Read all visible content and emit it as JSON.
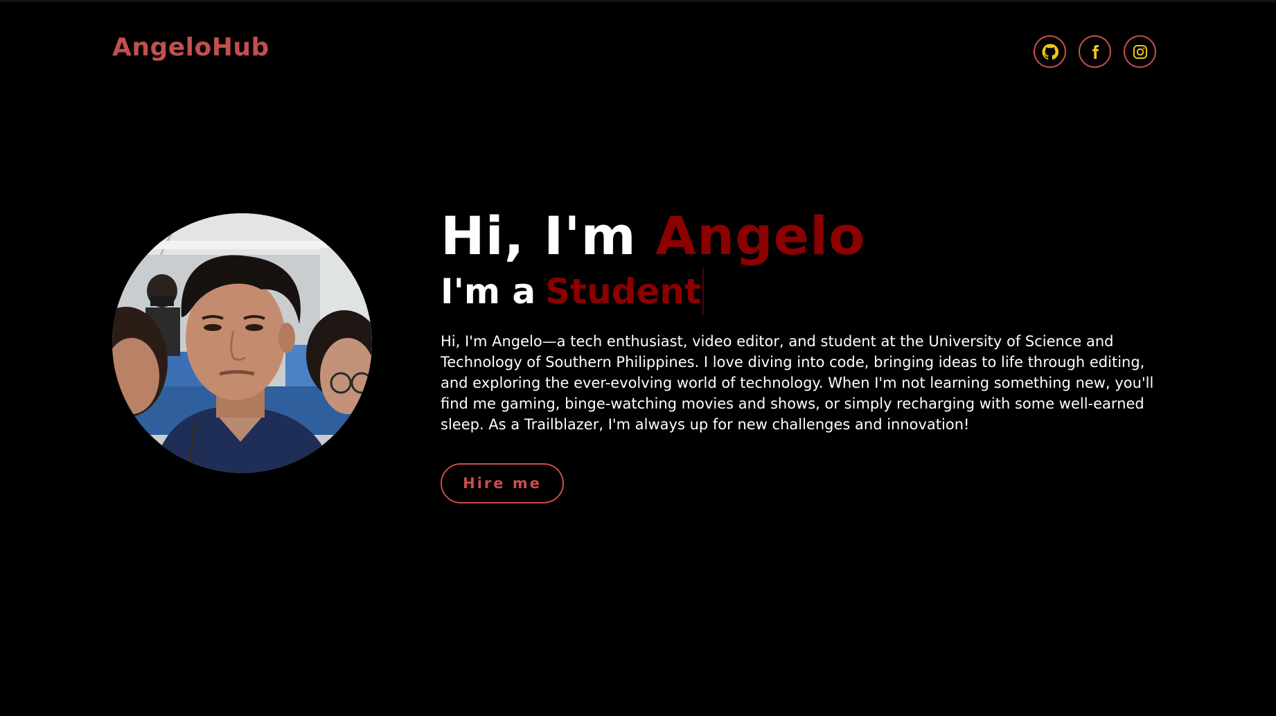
{
  "header": {
    "logo": "AngeloHub",
    "socials": [
      {
        "name": "github-icon"
      },
      {
        "name": "facebook-icon"
      },
      {
        "name": "instagram-icon"
      }
    ]
  },
  "hero": {
    "greeting": "Hi, I'm ",
    "name": "Angelo",
    "role_prefix": "I'm a",
    "role": "Student",
    "bio": "Hi, I'm Angelo—a tech enthusiast, video editor, and student at the University of Science and Technology of Southern Philippines. I love diving into code, bringing ideas to life through editing, and exploring the ever-evolving world of technology. When I'm not learning something new, you'll find me gaming, binge-watching movies and shows, or simply recharging with some well-earned sleep. As a Trailblazer, I'm always up for new challenges and innovation!",
    "cta_label": "Hire me"
  },
  "colors": {
    "background": "#000000",
    "accent": "#c8504d",
    "name_red": "#8b0000",
    "icon_yellow": "#f5c518",
    "text": "#ffffff"
  }
}
